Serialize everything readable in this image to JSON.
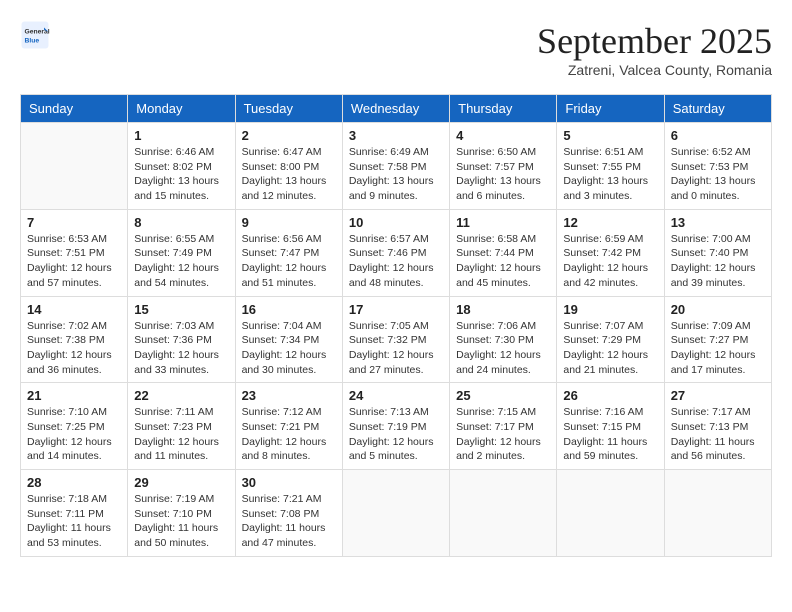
{
  "header": {
    "logo_general": "General",
    "logo_blue": "Blue",
    "month": "September 2025",
    "location": "Zatreni, Valcea County, Romania"
  },
  "days_of_week": [
    "Sunday",
    "Monday",
    "Tuesday",
    "Wednesday",
    "Thursday",
    "Friday",
    "Saturday"
  ],
  "weeks": [
    [
      {
        "day": "",
        "info": ""
      },
      {
        "day": "1",
        "info": "Sunrise: 6:46 AM\nSunset: 8:02 PM\nDaylight: 13 hours\nand 15 minutes."
      },
      {
        "day": "2",
        "info": "Sunrise: 6:47 AM\nSunset: 8:00 PM\nDaylight: 13 hours\nand 12 minutes."
      },
      {
        "day": "3",
        "info": "Sunrise: 6:49 AM\nSunset: 7:58 PM\nDaylight: 13 hours\nand 9 minutes."
      },
      {
        "day": "4",
        "info": "Sunrise: 6:50 AM\nSunset: 7:57 PM\nDaylight: 13 hours\nand 6 minutes."
      },
      {
        "day": "5",
        "info": "Sunrise: 6:51 AM\nSunset: 7:55 PM\nDaylight: 13 hours\nand 3 minutes."
      },
      {
        "day": "6",
        "info": "Sunrise: 6:52 AM\nSunset: 7:53 PM\nDaylight: 13 hours\nand 0 minutes."
      }
    ],
    [
      {
        "day": "7",
        "info": "Sunrise: 6:53 AM\nSunset: 7:51 PM\nDaylight: 12 hours\nand 57 minutes."
      },
      {
        "day": "8",
        "info": "Sunrise: 6:55 AM\nSunset: 7:49 PM\nDaylight: 12 hours\nand 54 minutes."
      },
      {
        "day": "9",
        "info": "Sunrise: 6:56 AM\nSunset: 7:47 PM\nDaylight: 12 hours\nand 51 minutes."
      },
      {
        "day": "10",
        "info": "Sunrise: 6:57 AM\nSunset: 7:46 PM\nDaylight: 12 hours\nand 48 minutes."
      },
      {
        "day": "11",
        "info": "Sunrise: 6:58 AM\nSunset: 7:44 PM\nDaylight: 12 hours\nand 45 minutes."
      },
      {
        "day": "12",
        "info": "Sunrise: 6:59 AM\nSunset: 7:42 PM\nDaylight: 12 hours\nand 42 minutes."
      },
      {
        "day": "13",
        "info": "Sunrise: 7:00 AM\nSunset: 7:40 PM\nDaylight: 12 hours\nand 39 minutes."
      }
    ],
    [
      {
        "day": "14",
        "info": "Sunrise: 7:02 AM\nSunset: 7:38 PM\nDaylight: 12 hours\nand 36 minutes."
      },
      {
        "day": "15",
        "info": "Sunrise: 7:03 AM\nSunset: 7:36 PM\nDaylight: 12 hours\nand 33 minutes."
      },
      {
        "day": "16",
        "info": "Sunrise: 7:04 AM\nSunset: 7:34 PM\nDaylight: 12 hours\nand 30 minutes."
      },
      {
        "day": "17",
        "info": "Sunrise: 7:05 AM\nSunset: 7:32 PM\nDaylight: 12 hours\nand 27 minutes."
      },
      {
        "day": "18",
        "info": "Sunrise: 7:06 AM\nSunset: 7:30 PM\nDaylight: 12 hours\nand 24 minutes."
      },
      {
        "day": "19",
        "info": "Sunrise: 7:07 AM\nSunset: 7:29 PM\nDaylight: 12 hours\nand 21 minutes."
      },
      {
        "day": "20",
        "info": "Sunrise: 7:09 AM\nSunset: 7:27 PM\nDaylight: 12 hours\nand 17 minutes."
      }
    ],
    [
      {
        "day": "21",
        "info": "Sunrise: 7:10 AM\nSunset: 7:25 PM\nDaylight: 12 hours\nand 14 minutes."
      },
      {
        "day": "22",
        "info": "Sunrise: 7:11 AM\nSunset: 7:23 PM\nDaylight: 12 hours\nand 11 minutes."
      },
      {
        "day": "23",
        "info": "Sunrise: 7:12 AM\nSunset: 7:21 PM\nDaylight: 12 hours\nand 8 minutes."
      },
      {
        "day": "24",
        "info": "Sunrise: 7:13 AM\nSunset: 7:19 PM\nDaylight: 12 hours\nand 5 minutes."
      },
      {
        "day": "25",
        "info": "Sunrise: 7:15 AM\nSunset: 7:17 PM\nDaylight: 12 hours\nand 2 minutes."
      },
      {
        "day": "26",
        "info": "Sunrise: 7:16 AM\nSunset: 7:15 PM\nDaylight: 11 hours\nand 59 minutes."
      },
      {
        "day": "27",
        "info": "Sunrise: 7:17 AM\nSunset: 7:13 PM\nDaylight: 11 hours\nand 56 minutes."
      }
    ],
    [
      {
        "day": "28",
        "info": "Sunrise: 7:18 AM\nSunset: 7:11 PM\nDaylight: 11 hours\nand 53 minutes."
      },
      {
        "day": "29",
        "info": "Sunrise: 7:19 AM\nSunset: 7:10 PM\nDaylight: 11 hours\nand 50 minutes."
      },
      {
        "day": "30",
        "info": "Sunrise: 7:21 AM\nSunset: 7:08 PM\nDaylight: 11 hours\nand 47 minutes."
      },
      {
        "day": "",
        "info": ""
      },
      {
        "day": "",
        "info": ""
      },
      {
        "day": "",
        "info": ""
      },
      {
        "day": "",
        "info": ""
      }
    ]
  ]
}
